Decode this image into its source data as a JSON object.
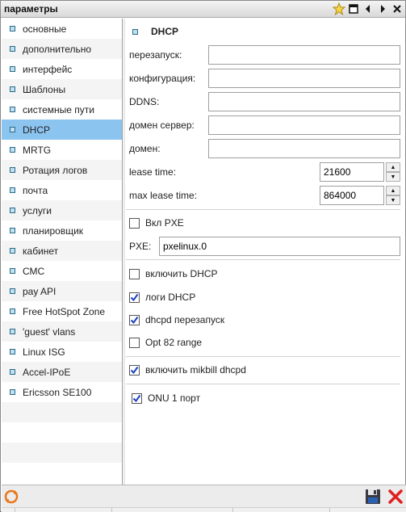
{
  "window": {
    "title": "параметры"
  },
  "titlebar": {
    "icons": [
      "star-icon",
      "restore-icon",
      "arrow-left-icon",
      "arrow-right-icon",
      "close-icon"
    ]
  },
  "sidebar": {
    "items": [
      {
        "label": "основные"
      },
      {
        "label": "дополнительно"
      },
      {
        "label": "интерфейс"
      },
      {
        "label": "Шаблоны"
      },
      {
        "label": "системные пути"
      },
      {
        "label": "DHCP",
        "active": true
      },
      {
        "label": "MRTG"
      },
      {
        "label": "Ротация логов"
      },
      {
        "label": "почта"
      },
      {
        "label": "услуги"
      },
      {
        "label": "планировщик"
      },
      {
        "label": "кабинет"
      },
      {
        "label": "СМС"
      },
      {
        "label": "pay API"
      },
      {
        "label": "Free HotSpot Zone"
      },
      {
        "label": "'guest' vlans"
      },
      {
        "label": "Linux ISG"
      },
      {
        "label": "Accel-IPoE"
      },
      {
        "label": "Ericsson SE100"
      }
    ]
  },
  "main": {
    "section_title": "DHCP",
    "fields": {
      "restart": {
        "label": "перезапуск:",
        "value": ""
      },
      "config": {
        "label": "конфигурация:",
        "value": ""
      },
      "ddns": {
        "label": "DDNS:",
        "value": ""
      },
      "domain_server": {
        "label": "домен сервер:",
        "value": ""
      },
      "domain": {
        "label": "домен:",
        "value": ""
      },
      "lease_time": {
        "label": "lease time:",
        "value": "21600"
      },
      "max_lease_time": {
        "label": "max lease time:",
        "value": "864000"
      },
      "pxe": {
        "label": "PXE:",
        "value": "pxelinux.0"
      }
    },
    "checkboxes": {
      "enable_pxe": {
        "label": "Вкл PXE",
        "checked": false
      },
      "enable_dhcp": {
        "label": "включить DHCP",
        "checked": false
      },
      "dhcp_logs": {
        "label": "логи DHCP",
        "checked": true
      },
      "dhcpd_restart": {
        "label": "dhcpd перезапуск",
        "checked": true
      },
      "opt82": {
        "label": "Opt 82 range",
        "checked": false
      },
      "mikbill_dhcpd": {
        "label": "включить mikbill dhcpd",
        "checked": true
      },
      "onu_port": {
        "label": "ONU 1 порт",
        "checked": true
      }
    }
  },
  "bottombar": {
    "icons": [
      "refresh-icon",
      "save-icon",
      "cancel-icon"
    ]
  },
  "colors": {
    "active_item": "#8cc4f0",
    "check": "#1a3fc4",
    "cancel": "#e02020",
    "refresh": "#e8761a"
  }
}
